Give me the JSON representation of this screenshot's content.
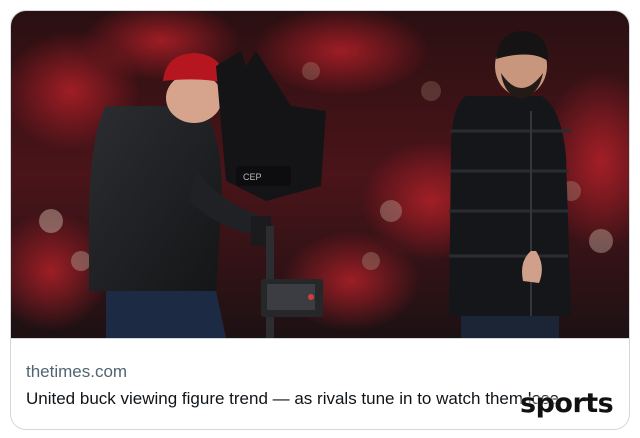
{
  "link_card": {
    "domain": "thetimes.com",
    "headline": "United buck viewing figure trend — as rivals tune in to watch them lose",
    "image_alt": "Cameraman in red beanie filming beside a man in a black puffer jacket in a stadium"
  },
  "watermark": {
    "text": "sports"
  },
  "colors": {
    "card_border": "#cfd9de",
    "domain_text": "#536471",
    "headline_text": "#0f1419",
    "stadium_red": "#9b1b22"
  }
}
